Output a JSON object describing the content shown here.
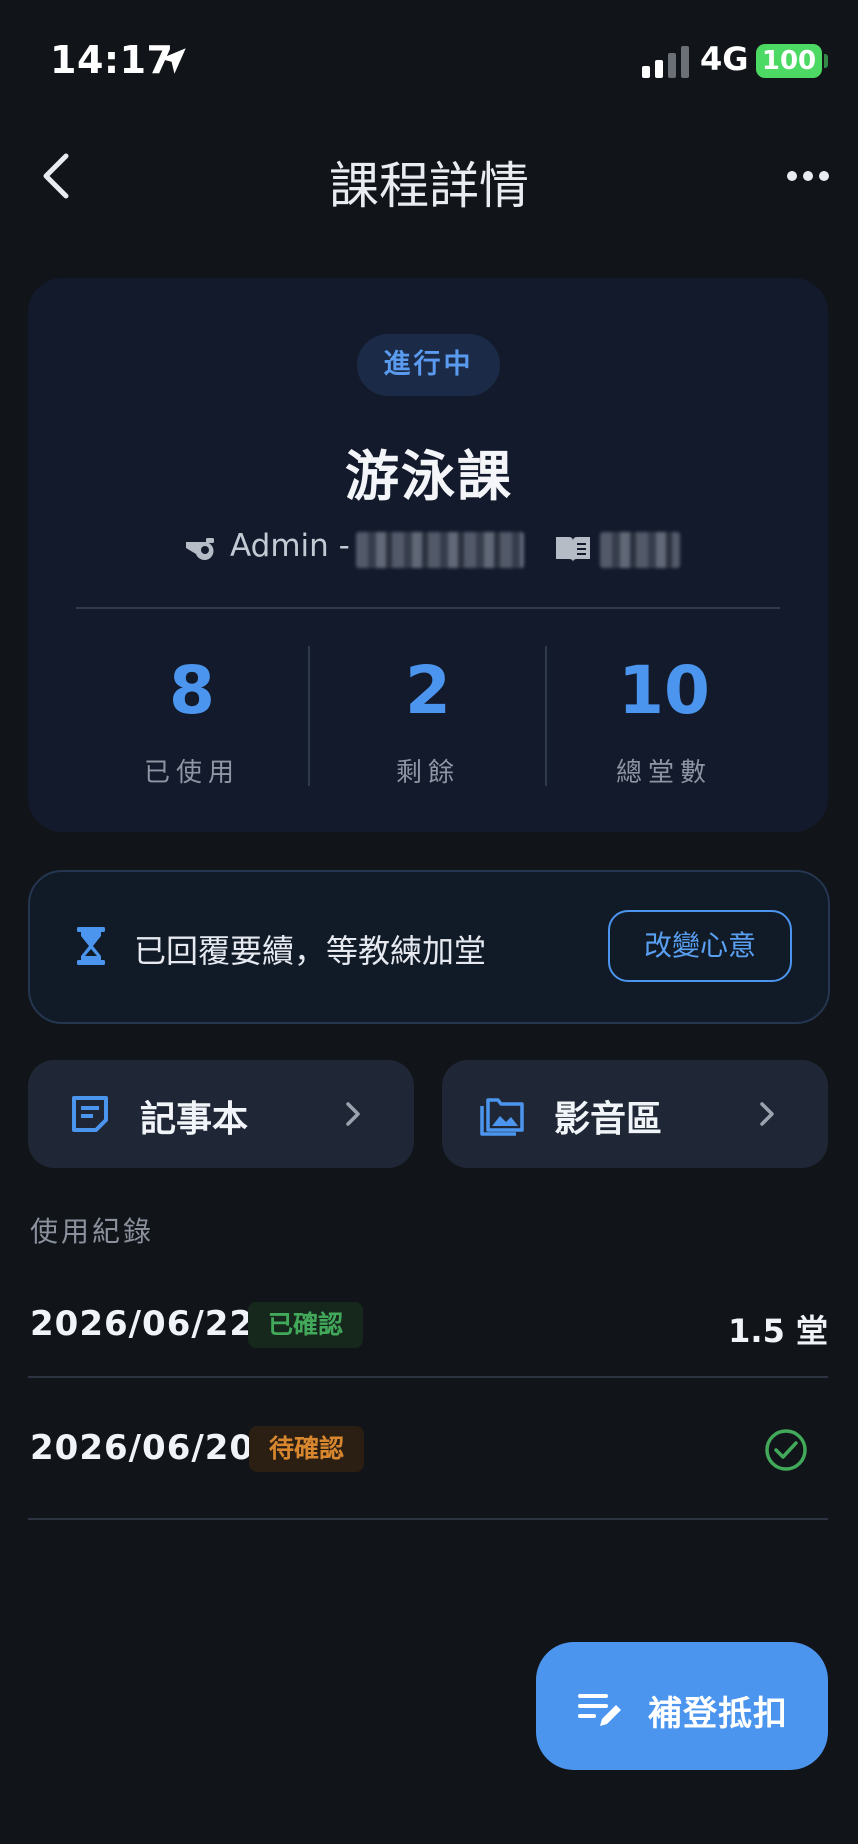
{
  "status_bar": {
    "time": "14:17",
    "network": "4G",
    "battery": "100"
  },
  "header": {
    "title": "課程詳情"
  },
  "course": {
    "status": "進行中",
    "name": "游泳課",
    "coach_prefix": "Admin -",
    "stats": [
      {
        "value": "8",
        "label": "已使用"
      },
      {
        "value": "2",
        "label": "剩餘"
      },
      {
        "value": "10",
        "label": "總堂數"
      }
    ]
  },
  "renewal": {
    "message": "已回覆要續，等教練加堂",
    "action": "改變心意"
  },
  "shortcuts": [
    {
      "label": "記事本",
      "icon": "note-icon"
    },
    {
      "label": "影音區",
      "icon": "gallery-icon"
    }
  ],
  "records": {
    "section_label": "使用紀錄",
    "items": [
      {
        "date": "2026/06/22",
        "status": "已確認",
        "amount": "1.5 堂"
      },
      {
        "date": "2026/06/20",
        "status": "待確認"
      }
    ]
  },
  "fab": {
    "label": "補登抵扣"
  },
  "colors": {
    "accent": "#4c95ee",
    "confirmed": "#42a85a",
    "pending": "#d8872e",
    "background": "#111418"
  }
}
